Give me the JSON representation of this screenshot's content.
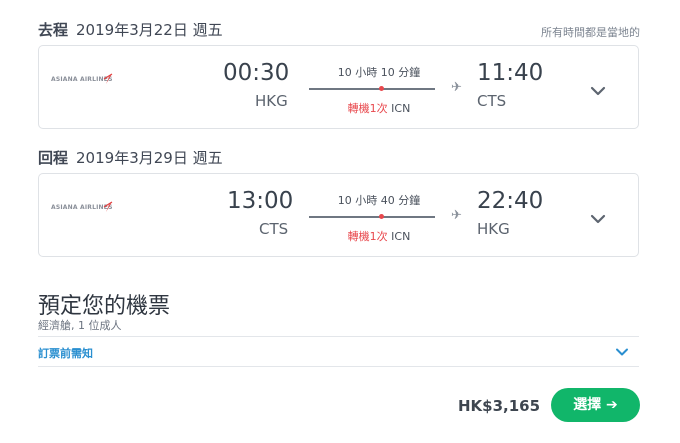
{
  "outbound": {
    "label": "去程",
    "date": "2019年3月22日 週五",
    "airline_logo_text": "ASIANA AIRLINES",
    "depart_time": "00:30",
    "depart_code": "HKG",
    "duration": "10 小時 10 分鐘",
    "stops_text": "轉機1次",
    "stop_airport": "ICN",
    "arrive_time": "11:40",
    "arrive_code": "CTS"
  },
  "timezone_note": "所有時間都是當地的",
  "return": {
    "label": "回程",
    "date": "2019年3月29日 週五",
    "airline_logo_text": "ASIANA AIRLINES",
    "depart_time": "13:00",
    "depart_code": "CTS",
    "duration": "10 小時 40 分鐘",
    "stops_text": "轉機1次",
    "stop_airport": "ICN",
    "arrive_time": "22:40",
    "arrive_code": "HKG"
  },
  "booking": {
    "title": "預定您的機票",
    "subtitle": "經濟艙, 1 位成人",
    "policy_link": "訂票前需知"
  },
  "footer": {
    "price": "HK$3,165",
    "select_label": "選擇 ➔"
  },
  "colors": {
    "accent_green": "#11b66a",
    "stop_red": "#e8484d",
    "link_blue": "#2a8fd0"
  },
  "icons": [
    "asiana-logo-icon",
    "plane-icon",
    "chevron-down-icon"
  ]
}
